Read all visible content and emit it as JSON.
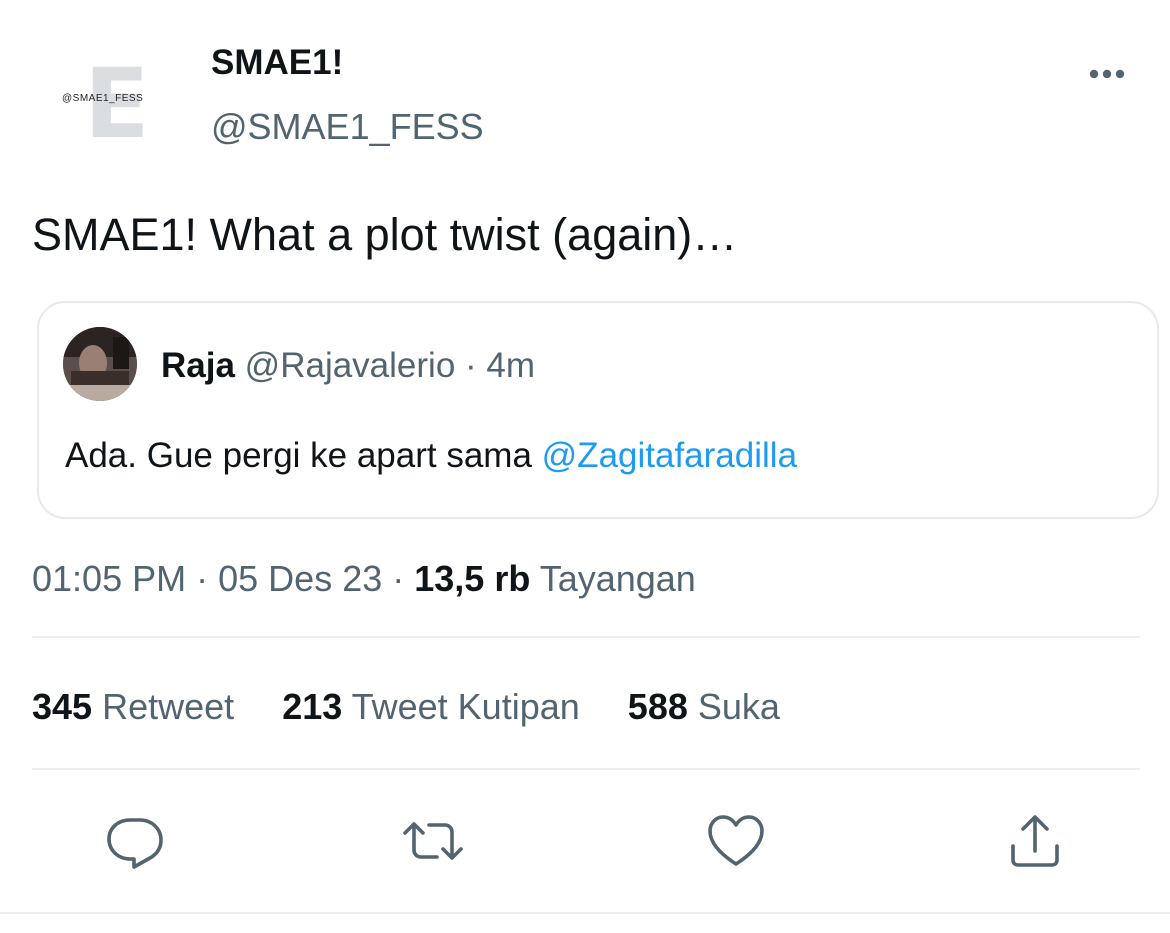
{
  "tweet": {
    "author": {
      "display_name": "SMAE1!",
      "handle": "@SMAE1_FESS",
      "avatar_text": "@SMAE1_FESS",
      "avatar_letter": "E"
    },
    "text": "SMAE1! What a plot twist (again)…",
    "quoted_tweet": {
      "name": "Raja",
      "handle": "@Rajavalerio",
      "separator": "·",
      "time": "4m",
      "text": "Ada. Gue pergi ke apart sama ",
      "mention": "@Zagitafaradilla"
    },
    "meta": {
      "time": "01:05 PM",
      "separator1": "·",
      "date": "05 Des 23",
      "separator2": "·",
      "views_count": "13,5 rb",
      "views_label": "Tayangan"
    },
    "stats": {
      "retweets_count": "345",
      "retweets_label": "Retweet",
      "quotes_count": "213",
      "quotes_label": "Tweet Kutipan",
      "likes_count": "588",
      "likes_label": "Suka"
    },
    "actions": {
      "reply_icon": "reply-icon",
      "retweet_icon": "retweet-icon",
      "like_icon": "heart-icon",
      "share_icon": "share-icon"
    }
  },
  "colors": {
    "text_primary": "#0f1419",
    "text_secondary": "#536471",
    "link": "#1d9bf0",
    "border": "#e6e9ec"
  }
}
